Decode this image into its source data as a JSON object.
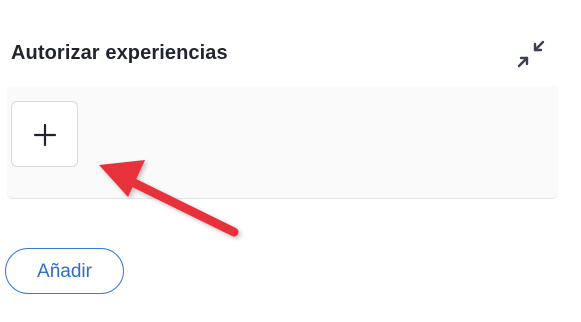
{
  "section": {
    "title": "Autorizar experiencias",
    "collapse_icon": "collapse-icon",
    "add_tile_icon": "plus-icon"
  },
  "annotation": {
    "arrow_color": "#e8333a"
  },
  "actions": {
    "add_label": "Añadir"
  },
  "colors": {
    "accent": "#3a7bd5",
    "title": "#1f2430"
  }
}
